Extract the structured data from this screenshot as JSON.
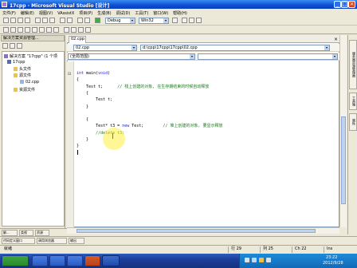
{
  "window": {
    "title": "17cpp - Microsoft Visual Studio [设计]"
  },
  "menu": [
    "文件(F)",
    "编辑(E)",
    "视图(V)",
    "VAssistX",
    "项目(P)",
    "生成(B)",
    "调试(D)",
    "工具(T)",
    "窗口(W)",
    "帮助(H)"
  ],
  "toolbar": {
    "config": "Debug",
    "platform": "Win32"
  },
  "solution_explorer": {
    "header": "解决方案资源管理...",
    "tree": [
      {
        "label": "解决方案 \"17cpp\" (1 个项"
      },
      {
        "label": "17cpp"
      },
      {
        "label": "头文件"
      },
      {
        "label": "源文件"
      },
      {
        "label": "02.cpp"
      },
      {
        "label": "资源文件"
      }
    ]
  },
  "editor": {
    "tab": "02.cpp",
    "file_combo": "02.cpp",
    "path": "d:\\cpp\\17cpp\\17cpp\\02.cpp",
    "scope": "(全局范围)",
    "lines": [
      {
        "parts": [
          [
            "kw",
            "int"
          ],
          [
            "tx",
            " main("
          ],
          [
            "kw",
            "void"
          ],
          [
            "tx",
            ")"
          ]
        ]
      },
      {
        "parts": [
          [
            "tx",
            "{"
          ]
        ]
      },
      {
        "parts": [
          [
            "tx",
            "    Test t;      "
          ],
          [
            "cm",
            "// 栈上创建的对象, 在生存期结束的时候自动释放"
          ]
        ]
      },
      {
        "parts": [
          [
            "tx",
            "    {"
          ]
        ]
      },
      {
        "parts": [
          [
            "tx",
            "        Test t;"
          ]
        ]
      },
      {
        "parts": [
          [
            "tx",
            "    }"
          ]
        ]
      },
      {
        "parts": [
          [
            "tx",
            ""
          ]
        ]
      },
      {
        "parts": [
          [
            "tx",
            "    {"
          ]
        ]
      },
      {
        "parts": [
          [
            "tx",
            "        Test* t3 = "
          ],
          [
            "kw",
            "new"
          ],
          [
            "tx",
            " Test;        "
          ],
          [
            "cm",
            "// 堆上创建的对象, 要显示释放"
          ]
        ]
      },
      {
        "parts": [
          [
            "cm",
            "        //delete t3;"
          ]
        ]
      },
      {
        "parts": [
          [
            "tx",
            "    }"
          ]
        ]
      },
      {
        "parts": [
          [
            "tx",
            "}"
          ]
        ]
      }
    ]
  },
  "right_tabs": [
    "服务器资源管理器",
    "工具箱",
    "属性"
  ],
  "bottom_tabs": [
    "解...",
    "类视",
    "资源"
  ],
  "output_tabs": [
    "代码定义窗口",
    "调用浏览器",
    "输出"
  ],
  "status": {
    "message": "就绪",
    "row": "行 29",
    "col": "列 25",
    "ch": "Ch 22",
    "mode": "Ins"
  },
  "clock": {
    "time": "23:22",
    "date": "2012/9/28"
  },
  "colors": {
    "title": "#0a4fd6",
    "keyword": "#1a1ae6",
    "comment": "#1a7a1a",
    "taskbar": "#1c3f9a"
  }
}
